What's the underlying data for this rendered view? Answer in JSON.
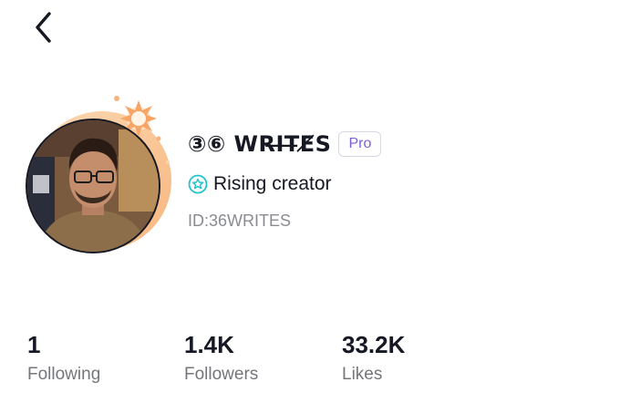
{
  "header": {
    "back_icon": "chevron-left-icon"
  },
  "profile": {
    "display_name": "③⑥ WRI̶T̶E̸S",
    "badge": "Pro",
    "creator_status": "Rising creator",
    "creator_icon": "star-badge-icon",
    "user_id": "ID:36WRITES"
  },
  "stats": [
    {
      "value": "1",
      "label": "Following"
    },
    {
      "value": "1.4K",
      "label": "Followers"
    },
    {
      "value": "33.2K",
      "label": "Likes"
    }
  ],
  "colors": {
    "text": "#161823",
    "badge_text": "#7b5fd6",
    "creator_icon": "#20c4cb",
    "secondary_text": "#8a8b91",
    "avatar_decoration": "#f7b37a"
  }
}
